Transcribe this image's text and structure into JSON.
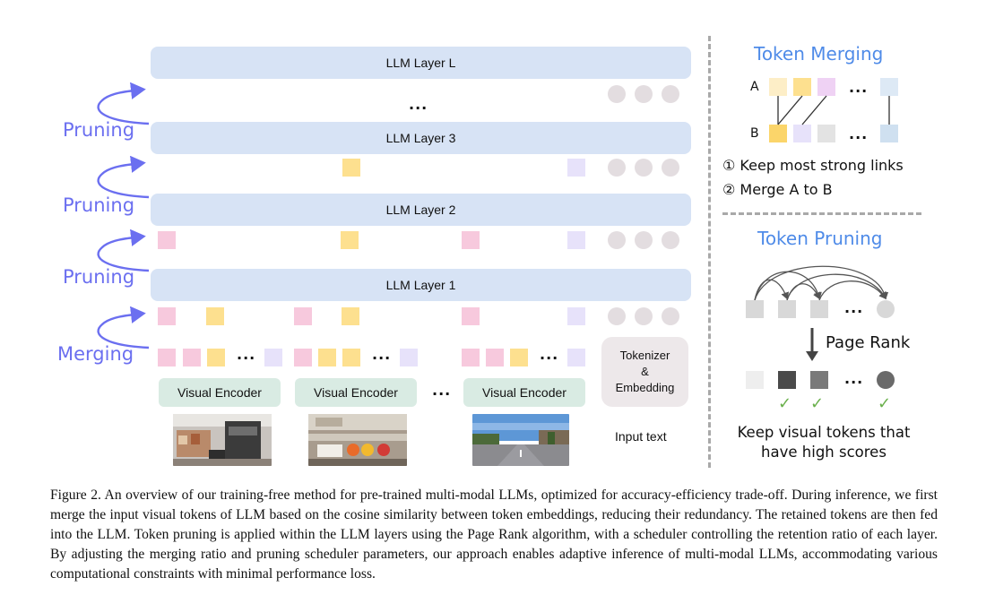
{
  "layers": {
    "l": "LLM Layer L",
    "l3": "LLM Layer 3",
    "l2": "LLM Layer 2",
    "l1": "LLM Layer 1"
  },
  "ellipsis": "...",
  "arrows": {
    "pruning": "Pruning",
    "merging": "Merging"
  },
  "encoder": {
    "label": "Visual Encoder"
  },
  "tokenizer": {
    "line1": "Tokenizer",
    "line2": "&",
    "line3": "Embedding"
  },
  "input_text": "Input text",
  "token_merging": {
    "title": "Token Merging",
    "row_a": "A",
    "row_b": "B",
    "step1": "① Keep most strong links",
    "step2": "② Merge A to B"
  },
  "token_pruning": {
    "title": "Token Pruning",
    "page_rank": "Page Rank",
    "keep_line1": "Keep visual tokens that",
    "keep_line2": "have high scores"
  },
  "caption": "Figure 2. An overview of our training-free method for pre-trained multi-modal LLMs, optimized for accuracy-efficiency trade-off. During inference, we first merge the input visual tokens of LLM based on the cosine similarity between token embeddings, reducing their redundancy. The retained tokens are then fed into the LLM. Token pruning is applied within the LLM layers using the Page Rank algorithm, with a scheduler controlling the retention ratio of each layer. By adjusting the merging ratio and pruning scheduler parameters, our approach enables adaptive inference of multi-modal LLMs, accommodating various computational constraints with minimal performance loss.",
  "colors": {
    "layer_bg": "#d7e3f5",
    "encoder_bg": "#d9ebe3",
    "pink": "#f7c9dd",
    "yellow": "#fde08f",
    "lavender": "#e7e2fa",
    "arrow_purple": "#6b6ff0",
    "title_blue": "#4f8be8",
    "check_green": "#6ab04c"
  }
}
